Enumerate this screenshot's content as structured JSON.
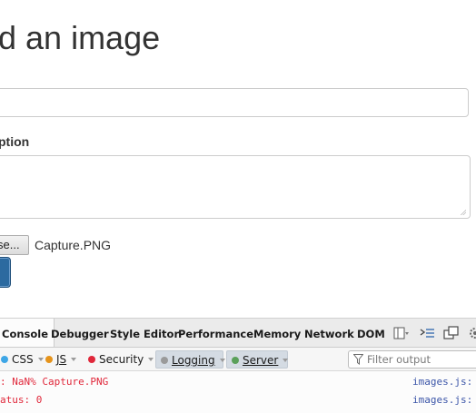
{
  "page": {
    "title": "d an image",
    "caption_label": "ption",
    "browse_label": "se...",
    "file_name": "Capture.PNG"
  },
  "devtools": {
    "tabs": [
      {
        "label": "Console",
        "active": true
      },
      {
        "label": "Debugger",
        "active": false
      },
      {
        "label": "Style Editor",
        "active": false
      },
      {
        "label": "Performance",
        "active": false
      },
      {
        "label": "Memory",
        "active": false
      },
      {
        "label": "Network",
        "active": false
      },
      {
        "label": "DOM",
        "active": false
      }
    ],
    "toolbar_icons": [
      "split-console-icon",
      "command-line-icon",
      "undock-icon",
      "settings-icon"
    ],
    "filters": [
      {
        "label": "CSS",
        "color": "#3ea6e6",
        "checked": false
      },
      {
        "label": "JS",
        "color": "#e5931b",
        "checked": false
      },
      {
        "label": "Security",
        "color": "#e0273a",
        "checked": false
      },
      {
        "label": "Logging",
        "color": "#9a9a9a",
        "checked": true
      },
      {
        "label": "Server",
        "color": "#5aa05a",
        "checked": true
      }
    ],
    "filter_placeholder": "Filter output",
    "log": [
      {
        "text": ": NaN% Capture.PNG",
        "source": "images.js:"
      },
      {
        "text": "atus: 0",
        "source": "images.js:"
      }
    ]
  },
  "colors": {
    "submit_button": "#2c6aa0",
    "error_text": "#e0273a",
    "source_link": "#3b55a8"
  }
}
